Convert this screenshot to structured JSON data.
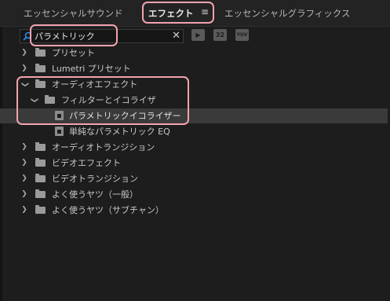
{
  "tabs": [
    {
      "label": "エッセンシャルサウンド",
      "active": false
    },
    {
      "label": "エフェクト",
      "active": true
    },
    {
      "label": "エッセンシャルグラフィックス",
      "active": false
    }
  ],
  "tab_menu_icon": "≡",
  "search": {
    "value": "パラメトリック",
    "placeholder": ""
  },
  "toolbar_buttons": [
    {
      "name": "accelerated-effects-icon",
      "glyph": "▶"
    },
    {
      "name": "32-bit-effects-icon",
      "glyph": "32"
    },
    {
      "name": "yuv-effects-icon",
      "glyph": "YUV"
    }
  ],
  "tree": [
    {
      "label": "プリセット",
      "expanded": false,
      "depth": 0,
      "type": "folder"
    },
    {
      "label": "Lumetri プリセット",
      "expanded": false,
      "depth": 0,
      "type": "folder"
    },
    {
      "label": "オーディオエフェクト",
      "expanded": true,
      "depth": 0,
      "type": "folder"
    },
    {
      "label": "フィルターとイコライザ",
      "expanded": true,
      "depth": 1,
      "type": "folder"
    },
    {
      "label": "パラメトリックイコライザー",
      "depth": 2,
      "type": "effect",
      "selected": true
    },
    {
      "label": "単純なパラメトリック EQ",
      "depth": 2,
      "type": "effect"
    },
    {
      "label": "オーディオトランジション",
      "expanded": false,
      "depth": 0,
      "type": "folder"
    },
    {
      "label": "ビデオエフェクト",
      "expanded": false,
      "depth": 0,
      "type": "folder"
    },
    {
      "label": "ビデオトランジション",
      "expanded": false,
      "depth": 0,
      "type": "folder"
    },
    {
      "label": "よく使うヤツ（一般）",
      "expanded": false,
      "depth": 0,
      "type": "folder"
    },
    {
      "label": "よく使うヤツ（サブチャン）",
      "expanded": false,
      "depth": 0,
      "type": "folder"
    }
  ],
  "colors": {
    "highlight": "#f2a3ae",
    "panel": "#1d1d1d",
    "accent": "#2d8ceb"
  }
}
